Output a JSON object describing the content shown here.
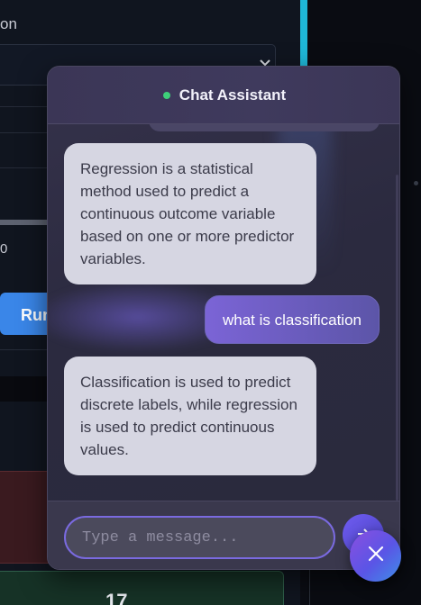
{
  "background": {
    "field_label": "on",
    "number_value": "0",
    "run_button_label": "Run",
    "card_number": "17"
  },
  "chat": {
    "title": "Chat Assistant",
    "status": "online",
    "messages": [
      {
        "role": "assistant",
        "text": "Regression is a statistical method used to predict a continuous outcome variable based on one or more predictor variables."
      },
      {
        "role": "user",
        "text": "what is classification"
      },
      {
        "role": "assistant",
        "text": "Classification is used to predict discrete labels, while regression is used to predict continuous values."
      }
    ],
    "input": {
      "placeholder": "Type a message...",
      "value": ""
    }
  },
  "colors": {
    "accent": "#7a6ae0",
    "status_online": "#3ed07a",
    "user_bubble": "#7b64d6",
    "assistant_bubble": "#d6d6e2"
  },
  "icons": {
    "send": "send-icon",
    "close": "close-icon",
    "chevron": "chevron-down-icon"
  }
}
